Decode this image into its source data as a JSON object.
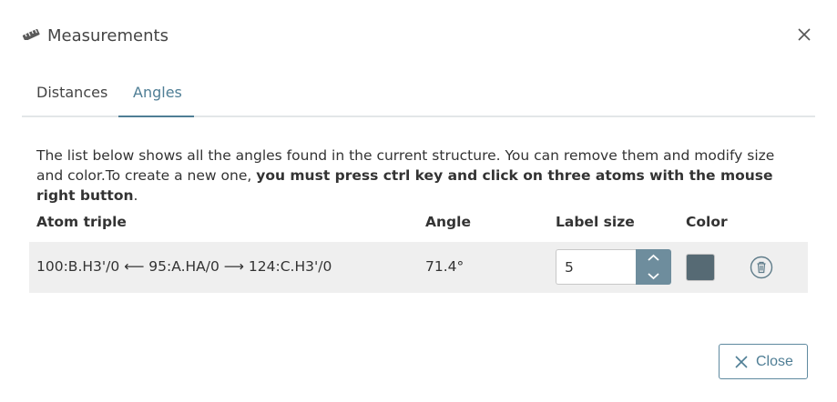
{
  "dialog": {
    "title": "Measurements",
    "icon": "ruler-icon"
  },
  "tabs": [
    {
      "label": "Distances",
      "active": false
    },
    {
      "label": "Angles",
      "active": true
    }
  ],
  "description": {
    "normal": "The list below shows all the angles found in the current structure. You can remove them and modify size and color.To create a new one, ",
    "bold": "you must press ctrl key and click on three atoms with the mouse right button",
    "end": "."
  },
  "table": {
    "headers": {
      "atom_triple": "Atom triple",
      "angle": "Angle",
      "label_size": "Label size",
      "color": "Color"
    },
    "rows": [
      {
        "atom_triple": "100:B.H3'/0 ⟵ 95:A.HA/0 ⟶ 124:C.H3'/0",
        "angle": "71.4°",
        "label_size": "5",
        "color": "#566a74"
      }
    ]
  },
  "footer": {
    "close_label": "Close"
  },
  "colors": {
    "accent": "#4f7e95",
    "spinner": "#6e8d9d",
    "row_bg": "#efefef"
  }
}
